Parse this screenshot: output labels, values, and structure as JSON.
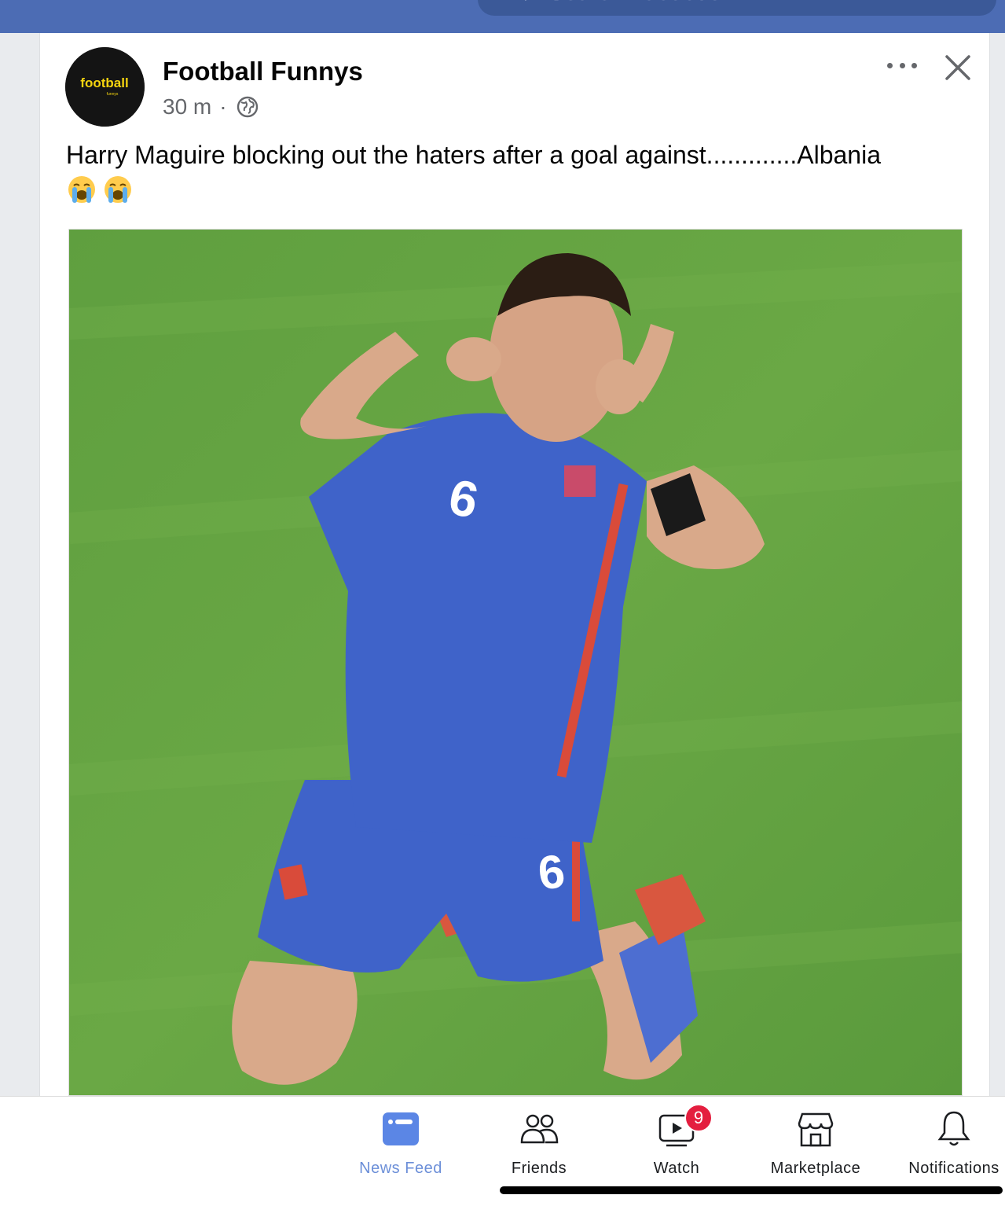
{
  "search": {
    "placeholder": "Search Facebook"
  },
  "post": {
    "author": "Football Funnys",
    "time": "30 m",
    "separator": "·",
    "caption": "Harry Maguire blocking out the haters after a goal against.............Albania",
    "emojis": [
      "loudly-crying-face",
      "loudly-crying-face"
    ],
    "avatar_text": "football",
    "avatar_subtext": "funnys",
    "image": {
      "shirt_number": "6",
      "colors": {
        "pitch": "#5a9a3c",
        "kit": "#3f63c9",
        "trim": "#d94b3a"
      }
    }
  },
  "bottom_nav": {
    "items": [
      {
        "label": "News Feed",
        "icon": "news-feed-icon",
        "active": true
      },
      {
        "label": "Friends",
        "icon": "friends-icon",
        "active": false
      },
      {
        "label": "Watch",
        "icon": "watch-icon",
        "active": false,
        "badge": "9"
      },
      {
        "label": "Marketplace",
        "icon": "marketplace-icon",
        "active": false
      },
      {
        "label": "Notifications",
        "icon": "bell-icon",
        "active": false
      }
    ]
  },
  "colors": {
    "brand": "#4c6cb4",
    "active": "#6c8fd8",
    "badge": "#e41e3f"
  }
}
